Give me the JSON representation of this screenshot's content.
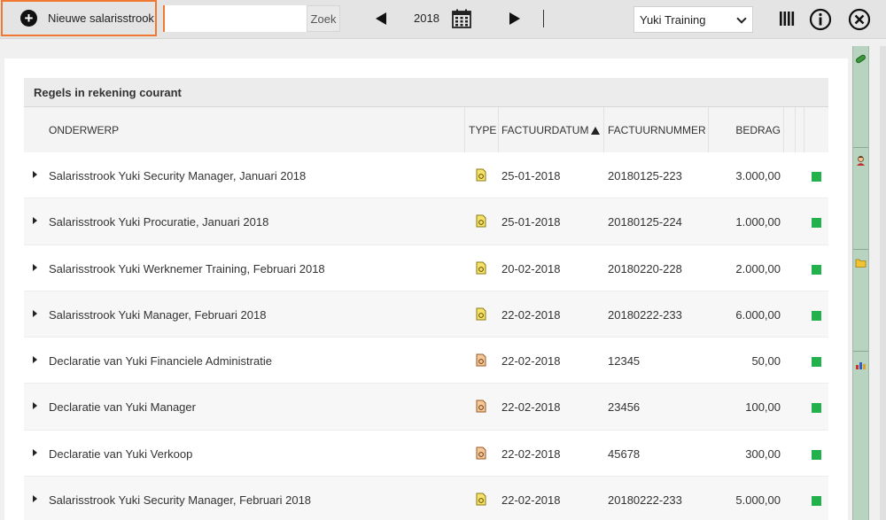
{
  "toolbar": {
    "new_label": "Nieuwe salarisstrook",
    "search_value": "",
    "search_button": "Zoek",
    "year": "2018",
    "company": "Yuki Training"
  },
  "section": {
    "title": "Regels in rekening courant"
  },
  "table": {
    "headers": {
      "subject": "ONDERWERP",
      "type": "TYPE",
      "date": "FACTUURDATUM",
      "number": "FACTUURNUMMER",
      "amount": "BEDRAG"
    },
    "rows": [
      {
        "subject": "Salarisstrook Yuki Security Manager, Januari 2018",
        "type": "salary-icon",
        "date": "25-01-2018",
        "number": "20180125-223",
        "amount": "3.000,00"
      },
      {
        "subject": "Salarisstrook Yuki Procuratie, Januari 2018",
        "type": "salary-icon",
        "date": "25-01-2018",
        "number": "20180125-224",
        "amount": "1.000,00"
      },
      {
        "subject": "Salarisstrook Yuki Werknemer Training, Februari 2018",
        "type": "salary-icon",
        "date": "20-02-2018",
        "number": "20180220-228",
        "amount": "2.000,00"
      },
      {
        "subject": "Salarisstrook Yuki Manager, Februari 2018",
        "type": "salary-icon",
        "date": "22-02-2018",
        "number": "20180222-233",
        "amount": "6.000,00"
      },
      {
        "subject": "Declaratie van Yuki Financiele Administratie",
        "type": "expense-icon",
        "date": "22-02-2018",
        "number": "12345",
        "amount": "50,00"
      },
      {
        "subject": "Declaratie van Yuki Manager",
        "type": "expense-icon",
        "date": "22-02-2018",
        "number": "23456",
        "amount": "100,00"
      },
      {
        "subject": "Declaratie van Yuki Verkoop",
        "type": "expense-icon",
        "date": "22-02-2018",
        "number": "45678",
        "amount": "300,00"
      },
      {
        "subject": "Salarisstrook Yuki Security Manager, Februari 2018",
        "type": "salary-icon",
        "date": "22-02-2018",
        "number": "20180222-233",
        "amount": "5.000,00"
      }
    ]
  },
  "colors": {
    "accent": "#f07830",
    "status_ok": "#22b14c",
    "sidebar": "#b8d4c0"
  },
  "sidebar_icons": [
    "paperclip-icon",
    "person-icon",
    "folder-icon",
    "chart-icon"
  ]
}
